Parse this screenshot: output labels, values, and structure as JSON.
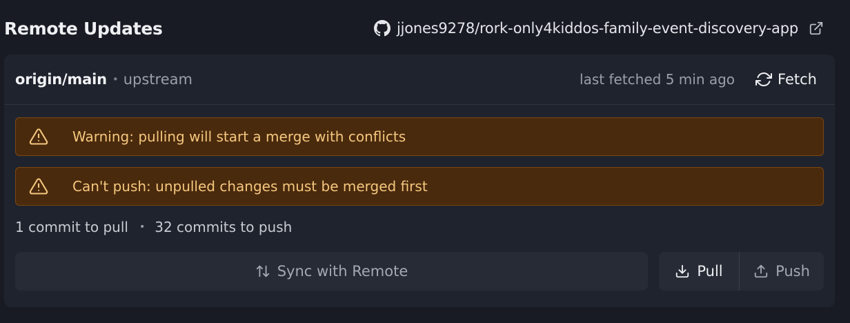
{
  "header": {
    "title": "Remote Updates",
    "repo": "jjones9278/rork-only4kiddos-family-event-discovery-app",
    "repo_icon": "github-icon",
    "open_icon": "external-link-icon"
  },
  "branch": {
    "name": "origin/main",
    "separator": "•",
    "tag": "upstream",
    "last_fetched": "last fetched 5 min ago",
    "fetch_label": "Fetch"
  },
  "warnings": [
    {
      "icon": "warning-triangle-icon",
      "text": "Warning: pulling will start a merge with conflicts"
    },
    {
      "icon": "warning-triangle-icon",
      "text": "Can't push: unpulled changes must be merged first"
    }
  ],
  "counts": {
    "pull": "1 commit to pull",
    "separator": "•",
    "push": "32 commits to push"
  },
  "actions": {
    "sync_label": "Sync with Remote",
    "pull_label": "Pull",
    "push_label": "Push"
  },
  "colors": {
    "background": "#181b23",
    "card": "#1f232d",
    "warning_bg": "#4a2a0d",
    "warning_border": "#7a4712",
    "warning_text": "#f5c77e",
    "button_bg": "#272b35"
  }
}
